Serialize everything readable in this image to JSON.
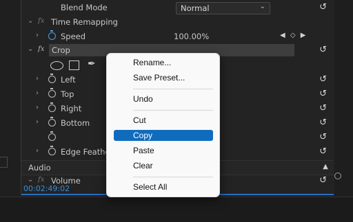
{
  "effects_panel": {
    "blend_mode": {
      "label": "Blend Mode",
      "value": "Normal"
    },
    "time_remapping": {
      "label": "Time Remapping"
    },
    "speed": {
      "label": "Speed",
      "value": "100.00%"
    },
    "crop": {
      "label": "Crop",
      "params": [
        {
          "label": "Left"
        },
        {
          "label": "Top"
        },
        {
          "label": "Right"
        },
        {
          "label": "Bottom"
        },
        {
          "label": ""
        },
        {
          "label": "Edge Feather"
        }
      ]
    },
    "audio": {
      "label": "Audio",
      "volume_label": "Volume"
    },
    "fx_glyph": "fx",
    "timecode": "00:02:49:02"
  },
  "context_menu": {
    "items": [
      {
        "label": "Rename..."
      },
      {
        "label": "Save Preset..."
      },
      {
        "label": "Undo"
      },
      {
        "label": "Cut"
      },
      {
        "label": "Copy",
        "highlighted": true
      },
      {
        "label": "Paste"
      },
      {
        "label": "Clear"
      },
      {
        "label": "Select All"
      }
    ]
  },
  "colors": {
    "accent": "#0f6cbd",
    "timecode": "#3b8fd6",
    "panel_bg": "#232323",
    "menu_bg": "#f9f9f9"
  },
  "icons": {
    "reset": "reset-icon",
    "stopwatch": "stopwatch-icon",
    "chevron": "chevron-right-icon",
    "pen": "pen-tool-icon"
  }
}
